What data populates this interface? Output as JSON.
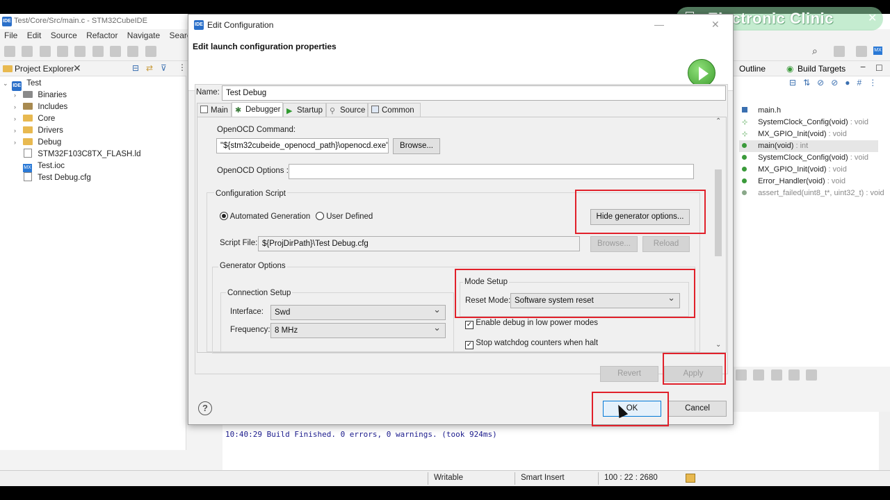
{
  "ide": {
    "title": "Test/Core/Src/main.c - STM32CubeIDE",
    "menu": [
      "File",
      "Edit",
      "Source",
      "Refactor",
      "Navigate",
      "Search"
    ],
    "explorer": {
      "title": "Project Explorer",
      "root": "Test",
      "items": [
        {
          "label": "Binaries",
          "expandable": true
        },
        {
          "label": "Includes",
          "expandable": true
        },
        {
          "label": "Core",
          "expandable": true
        },
        {
          "label": "Drivers",
          "expandable": true
        },
        {
          "label": "Debug",
          "expandable": true
        },
        {
          "label": "STM32F103C8TX_FLASH.ld",
          "expandable": false
        },
        {
          "label": "Test.ioc",
          "expandable": false
        },
        {
          "label": "Test Debug.cfg",
          "expandable": false
        }
      ]
    },
    "outline": {
      "tabs": [
        "Outline",
        "Build Targets"
      ],
      "items": [
        {
          "name": "main.h",
          "type": ""
        },
        {
          "name": "SystemClock_Config(void)",
          "type": " : void"
        },
        {
          "name": "MX_GPIO_Init(void)",
          "type": " : void"
        },
        {
          "name": "main(void)",
          "type": " : int"
        },
        {
          "name": "SystemClock_Config(void)",
          "type": " : void"
        },
        {
          "name": "MX_GPIO_Init(void)",
          "type": " : void"
        },
        {
          "name": "Error_Handler(void)",
          "type": " : void"
        },
        {
          "name": "assert_failed(uint8_t*, uint32_t)",
          "type": " : void"
        }
      ]
    },
    "console": {
      "line": "10:40:29 Build Finished. 0 errors, 0 warnings. (took 924ms)"
    },
    "status": {
      "writable": "Writable",
      "insert_mode": "Smart Insert",
      "position": "100 : 22 : 2680"
    }
  },
  "watermark": "Electronic Clinic",
  "dialog": {
    "title": "Edit Configuration",
    "subtitle": "Edit launch configuration properties",
    "name_label": "Name:",
    "name_value": "Test Debug",
    "tabs": [
      "Main",
      "Debugger",
      "Startup",
      "Source",
      "Common"
    ],
    "active_tab": "Debugger",
    "openocd_command_label": "OpenOCD Command:",
    "openocd_command_value": "\"${stm32cubeide_openocd_path}\\openocd.exe\"",
    "browse_label": "Browse...",
    "openocd_options_label": "OpenOCD Options :",
    "openocd_options_value": "",
    "config_script_label": "Configuration Script",
    "radio_automated": "Automated Generation",
    "radio_user": "User Defined",
    "hide_generator_label": "Hide generator options...",
    "script_file_label": "Script File:",
    "script_file_value": "${ProjDirPath}\\Test Debug.cfg",
    "script_browse_label": "Browse...",
    "reload_label": "Reload",
    "generator_options_label": "Generator Options",
    "connection_setup_label": "Connection Setup",
    "interface_label": "Interface:",
    "interface_value": "Swd",
    "frequency_label": "Frequency:",
    "frequency_value": "8 MHz",
    "mode_setup_label": "Mode Setup",
    "reset_mode_label": "Reset Mode:",
    "reset_mode_value": "Software system reset",
    "enable_debug_low_power": "Enable debug in low power modes",
    "stop_watchdog": "Stop watchdog counters when halt",
    "revert_label": "Revert",
    "apply_label": "Apply",
    "ok_label": "OK",
    "cancel_label": "Cancel",
    "help_icon": "?"
  }
}
